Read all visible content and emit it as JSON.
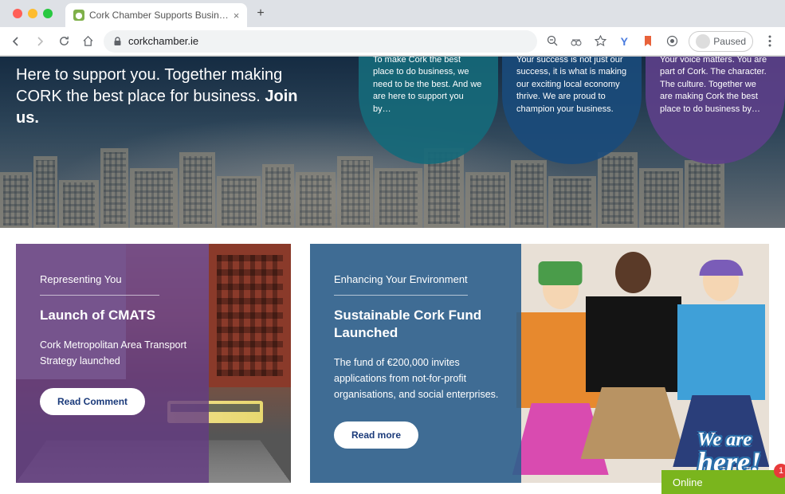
{
  "browser": {
    "tab_title": "Cork Chamber Supports Busin…",
    "url": "corkchamber.ie",
    "paused_label": "Paused"
  },
  "hero": {
    "line1": "Here to support you. Together making",
    "line2_pre": "CORK the best place for business. ",
    "line2_bold": "Join us.",
    "circles": [
      {
        "text": "To make Cork the best place to do business, we need to be the best. And we are here to support you by…"
      },
      {
        "text": "Your success is not just our success, it is what is making our exciting local economy thrive. We are proud to champion your business."
      },
      {
        "text": "Your voice matters. You are part of Cork. The character. The culture. Together we are making Cork the best place to do business by…"
      }
    ]
  },
  "cards": [
    {
      "eyebrow": "Representing You",
      "title": "Launch of CMATS",
      "desc": "Cork Metropolitan Area Transport Strategy launched",
      "button": "Read Comment"
    },
    {
      "eyebrow": "Enhancing Your Environment",
      "title": "Sustainable Cork Fund Launched",
      "desc": "The fund of €200,000 invites applications from not-for-profit organisations, and social enterprises.",
      "button": "Read more"
    }
  ],
  "wearehere": {
    "line1": "We are",
    "line2": "here!"
  },
  "chat": {
    "status": "Online",
    "badge": "1"
  }
}
